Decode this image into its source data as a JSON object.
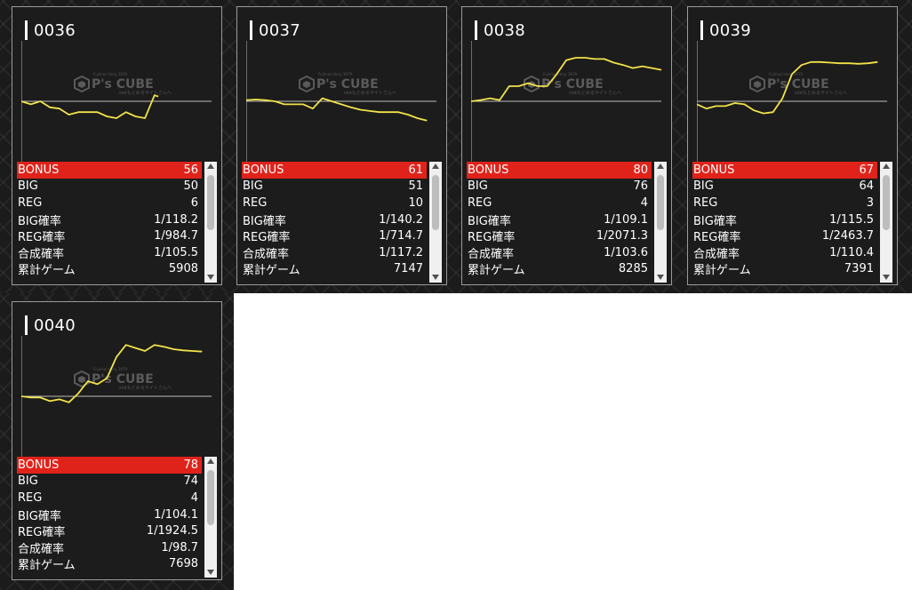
{
  "colors": {
    "accent": "#e0231a",
    "line": "#f2e34a",
    "card_bg": "#1c1c1c",
    "axis": "#bdbdbd"
  },
  "watermark": {
    "line1": "Fujimac'story 3979",
    "brand": "P's CUBE",
    "line2": "slotもとめるサイトさんへ",
    "icon": "cube-logo-icon"
  },
  "stat_labels": {
    "bonus": "BONUS",
    "big": "BIG",
    "reg": "REG",
    "big_rate": "BIG確率",
    "reg_rate": "REG確率",
    "combined_rate": "合成確率",
    "total_games": "累計ゲーム"
  },
  "machines": [
    {
      "id": "0036",
      "bonus": "56",
      "big": "50",
      "reg": "6",
      "big_rate": "1/118.2",
      "reg_rate": "1/984.7",
      "combined_rate": "1/105.5",
      "total_games": "5908"
    },
    {
      "id": "0037",
      "bonus": "61",
      "big": "51",
      "reg": "10",
      "big_rate": "1/140.2",
      "reg_rate": "1/714.7",
      "combined_rate": "1/117.2",
      "total_games": "7147"
    },
    {
      "id": "0038",
      "bonus": "80",
      "big": "76",
      "reg": "4",
      "big_rate": "1/109.1",
      "reg_rate": "1/2071.3",
      "combined_rate": "1/103.6",
      "total_games": "8285"
    },
    {
      "id": "0039",
      "bonus": "67",
      "big": "64",
      "reg": "3",
      "big_rate": "1/115.5",
      "reg_rate": "1/2463.7",
      "combined_rate": "1/110.4",
      "total_games": "7391"
    },
    {
      "id": "0040",
      "bonus": "78",
      "big": "74",
      "reg": "4",
      "big_rate": "1/104.1",
      "reg_rate": "1/1924.5",
      "combined_rate": "1/98.7",
      "total_games": "7698"
    }
  ],
  "chart_data": [
    {
      "type": "line",
      "machine": "0036",
      "x_extent": [
        0,
        1
      ],
      "y_extent": [
        -1,
        1
      ],
      "x": [
        0,
        0.05,
        0.1,
        0.15,
        0.2,
        0.25,
        0.3,
        0.35,
        0.4,
        0.45,
        0.5,
        0.55,
        0.6,
        0.65,
        0.7,
        0.72
      ],
      "values": [
        0,
        -0.05,
        0,
        -0.1,
        -0.12,
        -0.22,
        -0.18,
        -0.18,
        -0.18,
        -0.25,
        -0.28,
        -0.18,
        -0.25,
        -0.28,
        0.1,
        0.08
      ]
    },
    {
      "type": "line",
      "machine": "0037",
      "x_extent": [
        0,
        1
      ],
      "y_extent": [
        -1,
        1
      ],
      "x": [
        0,
        0.05,
        0.1,
        0.15,
        0.2,
        0.25,
        0.3,
        0.35,
        0.4,
        0.45,
        0.5,
        0.55,
        0.6,
        0.65,
        0.7,
        0.75,
        0.8,
        0.85,
        0.9,
        0.95
      ],
      "values": [
        0.02,
        0.03,
        0.02,
        0,
        -0.05,
        -0.05,
        -0.05,
        -0.12,
        0.05,
        0,
        -0.05,
        -0.1,
        -0.14,
        -0.16,
        -0.18,
        -0.18,
        -0.18,
        -0.22,
        -0.28,
        -0.32
      ]
    },
    {
      "type": "line",
      "machine": "0038",
      "x_extent": [
        0,
        1
      ],
      "y_extent": [
        -1,
        1
      ],
      "x": [
        0,
        0.05,
        0.1,
        0.15,
        0.2,
        0.25,
        0.3,
        0.35,
        0.4,
        0.45,
        0.5,
        0.55,
        0.6,
        0.65,
        0.7,
        0.75,
        0.8,
        0.85,
        0.9,
        0.95,
        1
      ],
      "values": [
        0,
        0.02,
        0.05,
        0.02,
        0.25,
        0.25,
        0.3,
        0.25,
        0.25,
        0.45,
        0.68,
        0.72,
        0.72,
        0.7,
        0.7,
        0.64,
        0.6,
        0.55,
        0.58,
        0.55,
        0.52
      ]
    },
    {
      "type": "line",
      "machine": "0039",
      "x_extent": [
        0,
        1
      ],
      "y_extent": [
        -1,
        1
      ],
      "x": [
        0,
        0.05,
        0.1,
        0.15,
        0.2,
        0.25,
        0.3,
        0.35,
        0.4,
        0.45,
        0.5,
        0.55,
        0.6,
        0.65,
        0.7,
        0.75,
        0.8,
        0.85,
        0.9,
        0.95
      ],
      "values": [
        -0.05,
        -0.12,
        -0.08,
        -0.08,
        -0.03,
        -0.05,
        -0.15,
        -0.2,
        -0.18,
        0.05,
        0.45,
        0.6,
        0.65,
        0.65,
        0.64,
        0.63,
        0.63,
        0.62,
        0.63,
        0.65
      ]
    },
    {
      "type": "line",
      "machine": "0040",
      "x_extent": [
        0,
        1
      ],
      "y_extent": [
        -1,
        1
      ],
      "x": [
        0,
        0.05,
        0.1,
        0.15,
        0.2,
        0.25,
        0.3,
        0.35,
        0.4,
        0.45,
        0.5,
        0.55,
        0.6,
        0.65,
        0.7,
        0.75,
        0.8,
        0.85,
        0.9,
        0.95
      ],
      "values": [
        0,
        -0.02,
        -0.02,
        -0.08,
        -0.05,
        -0.1,
        0.05,
        0.25,
        0.2,
        0.3,
        0.65,
        0.85,
        0.8,
        0.75,
        0.85,
        0.82,
        0.78,
        0.76,
        0.75,
        0.74
      ]
    }
  ]
}
